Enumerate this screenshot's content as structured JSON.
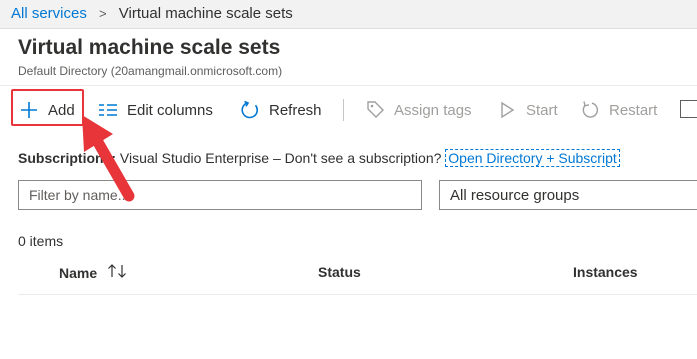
{
  "breadcrumb": {
    "link": "All services",
    "separator": ">",
    "current": "Virtual machine scale sets"
  },
  "page": {
    "title": "Virtual machine scale sets",
    "subtitle": "Default Directory (20amangmail.onmicrosoft.com)"
  },
  "toolbar": {
    "add": "Add",
    "edit_columns": "Edit columns",
    "refresh": "Refresh",
    "assign_tags": "Assign tags",
    "start": "Start",
    "restart": "Restart"
  },
  "subscriptions": {
    "label": "Subscriptions:",
    "value": "Visual Studio Enterprise – Don't see a subscription?",
    "link": "Open Directory + Subscript"
  },
  "filter": {
    "placeholder": "Filter by name..."
  },
  "resource_groups": {
    "value": "All resource groups"
  },
  "list": {
    "count": "0 items",
    "columns": {
      "name": "Name",
      "status": "Status",
      "instances": "Instances"
    }
  },
  "colors": {
    "accent": "#0078d4",
    "highlight": "#e8353a",
    "disabled": "#a19f9d"
  },
  "icons": {
    "add": "plus-icon",
    "edit": "columns-icon",
    "refresh": "refresh-icon",
    "tags": "tag-icon",
    "start": "play-icon",
    "restart": "restart-icon",
    "sort": "sort-icon"
  }
}
